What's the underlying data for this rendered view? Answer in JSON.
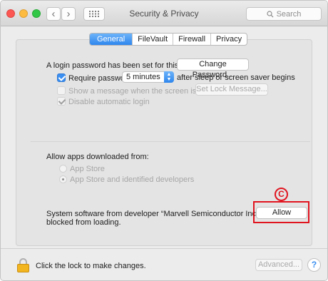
{
  "titlebar": {
    "title": "Security & Privacy",
    "search_placeholder": "Search",
    "back_glyph": "‹",
    "forward_glyph": "›"
  },
  "tabs": [
    {
      "label": "General",
      "active": true
    },
    {
      "label": "FileVault",
      "active": false
    },
    {
      "label": "Firewall",
      "active": false
    },
    {
      "label": "Privacy",
      "active": false
    }
  ],
  "general": {
    "login_text": "A login password has been set for this user",
    "change_password_label": "Change Password...",
    "require_password_label": "Require password",
    "require_password_checked": true,
    "require_delay_value": "5 minutes",
    "require_suffix": "after sleep or screen saver begins",
    "show_message_label": "Show a message when the screen is locked",
    "set_lock_message_label": "Set Lock Message...",
    "disable_auto_login_label": "Disable automatic login"
  },
  "downloads": {
    "heading": "Allow apps downloaded from:",
    "options": [
      {
        "label": "App Store",
        "selected": false
      },
      {
        "label": "App Store and identified developers",
        "selected": true
      }
    ]
  },
  "blocked": {
    "message_line1": "System software from developer “Marvell Semiconductor Inc” was",
    "message_line2": "blocked from loading.",
    "allow_label": "Allow",
    "annotation_letter": "C"
  },
  "footer": {
    "lock_text": "Click the lock to make changes.",
    "advanced_label": "Advanced...",
    "help_label": "?"
  },
  "colors": {
    "accent": "#3b8ff0",
    "annotation": "#e0141f"
  },
  "icons": [
    "back-icon",
    "forward-icon",
    "grid-icon",
    "search-icon",
    "lock-icon",
    "help-icon"
  ]
}
